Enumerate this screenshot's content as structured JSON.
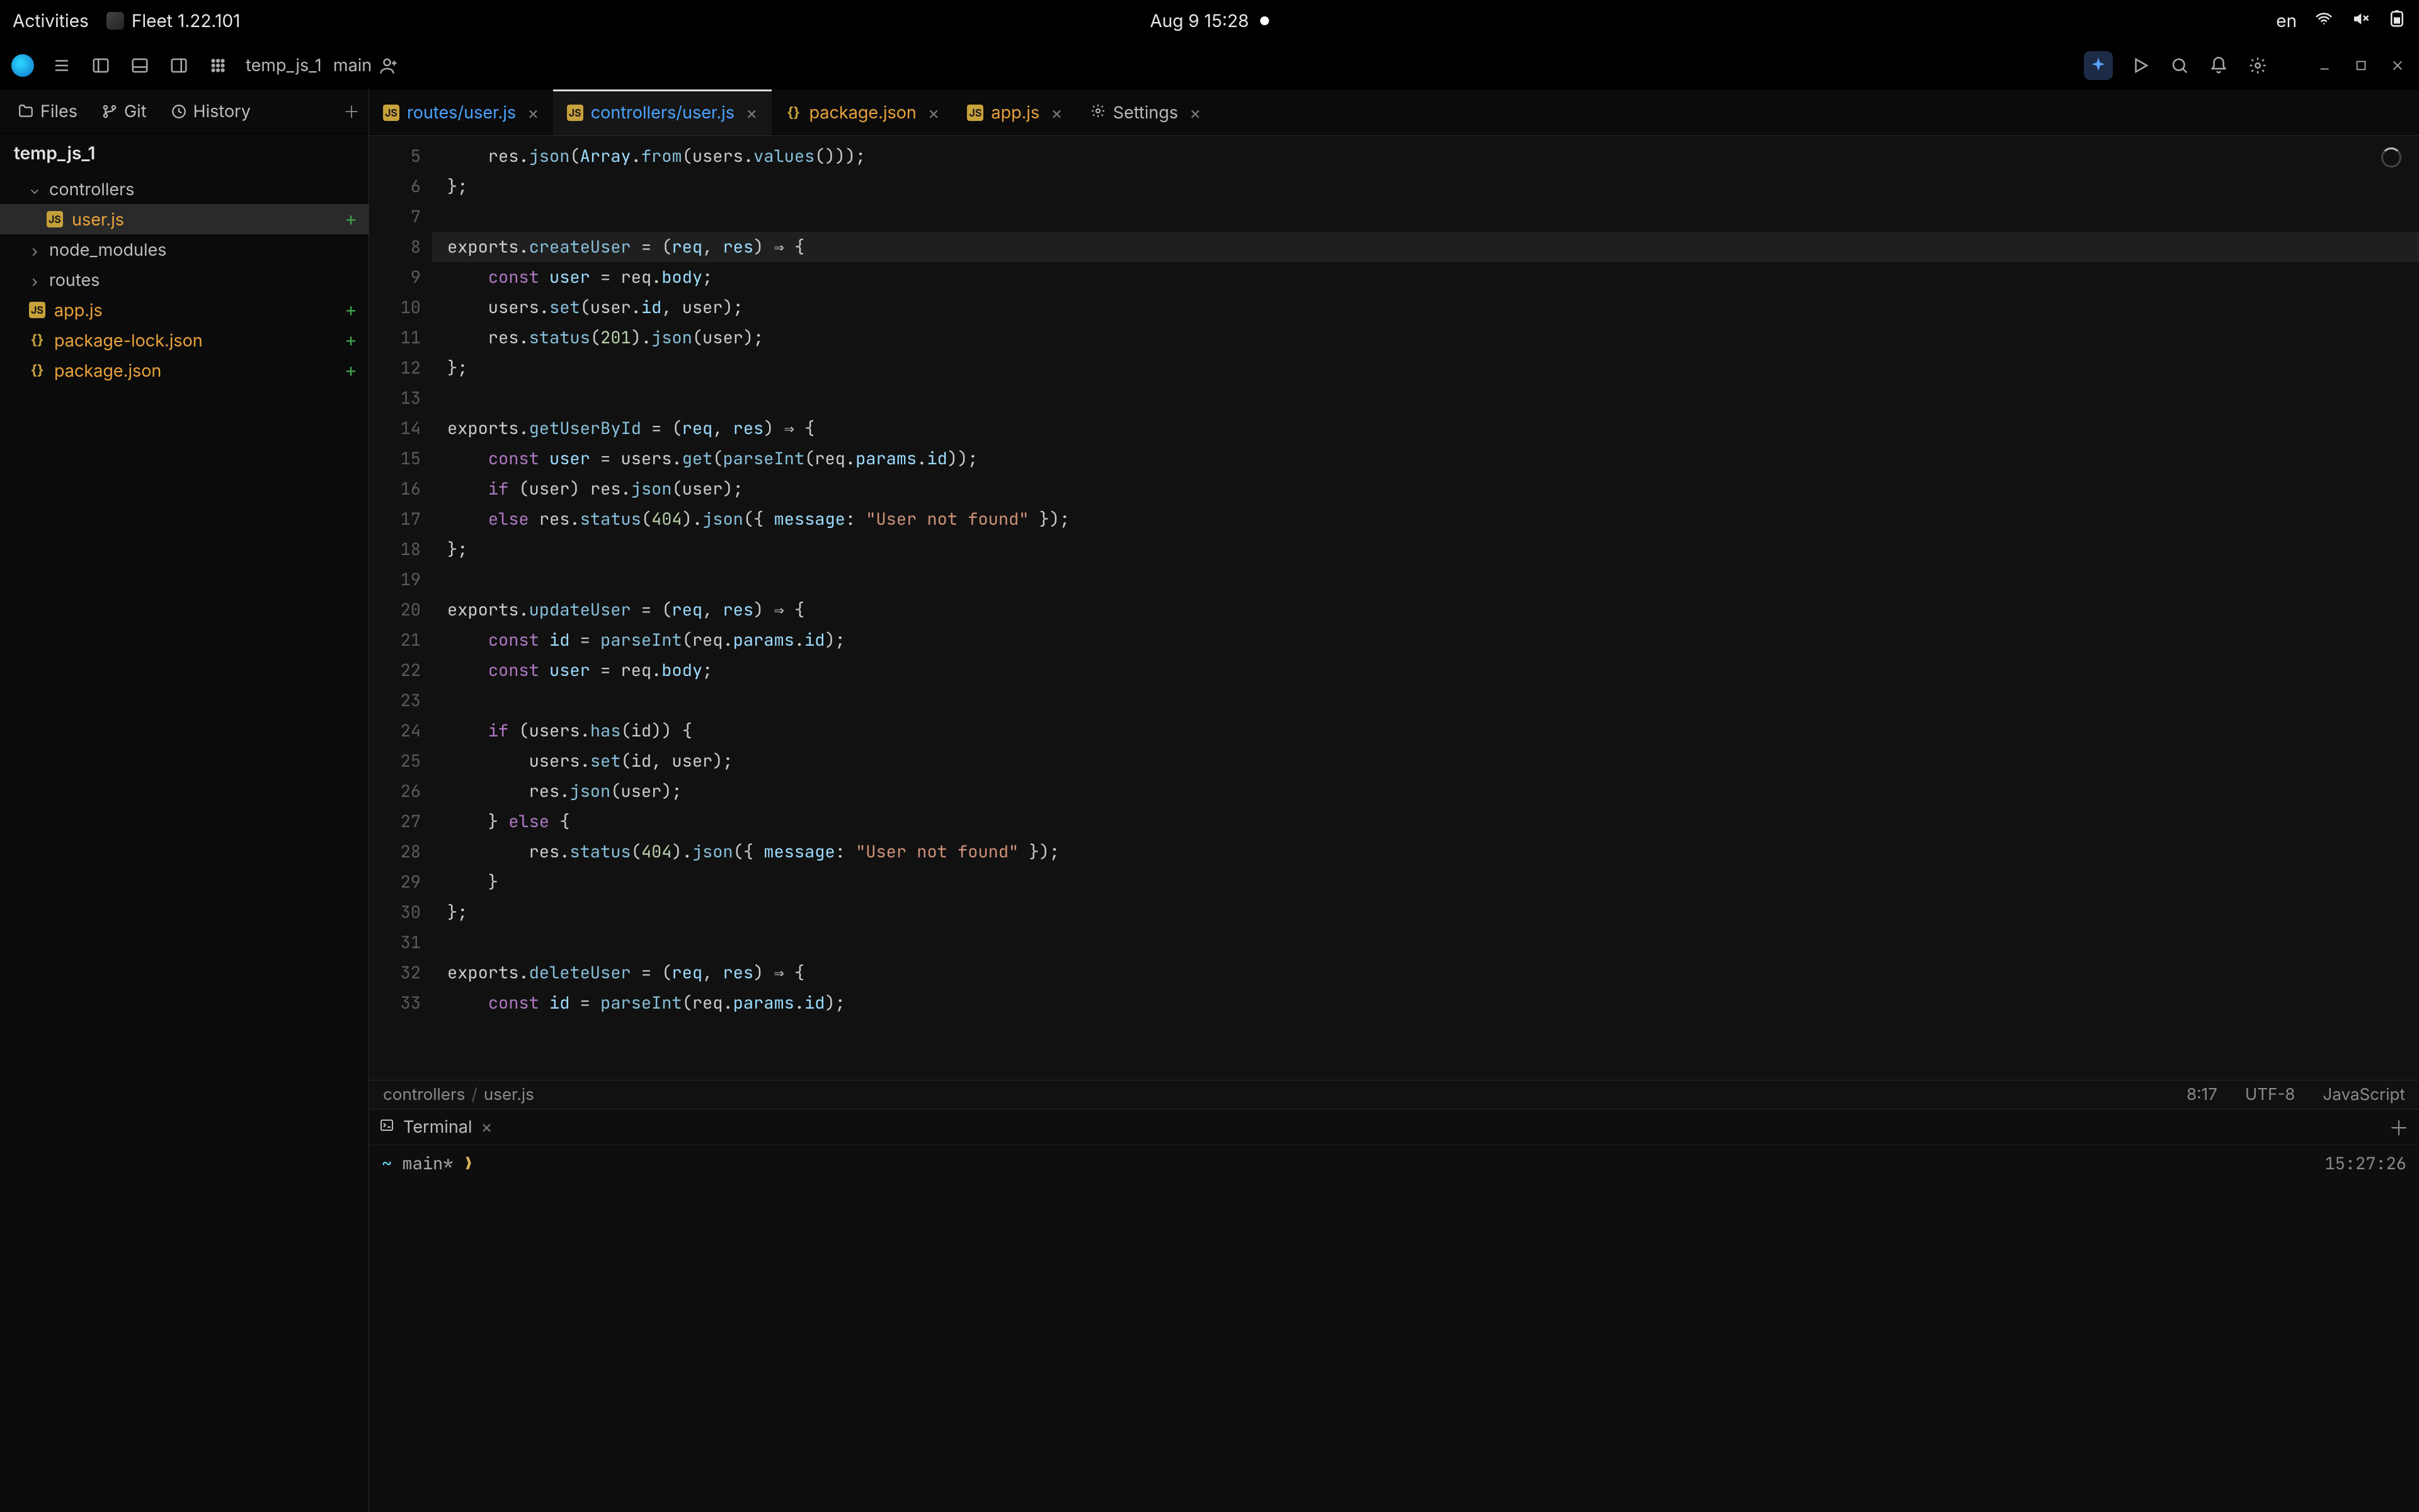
{
  "os": {
    "activities": "Activities",
    "app_name": "Fleet 1.22.101",
    "clock": "Aug 9  15:28",
    "lang": "en"
  },
  "toolbar": {
    "project": "temp_js_1",
    "branch": "main"
  },
  "sidebar": {
    "tabs": {
      "files": "Files",
      "git": "Git",
      "history": "History"
    },
    "root": "temp_js_1",
    "tree": [
      {
        "type": "dir",
        "name": "controllers",
        "expanded": true,
        "depth": 1
      },
      {
        "type": "file",
        "name": "user.js",
        "kind": "js",
        "depth": 2,
        "active": true,
        "added": true,
        "orange": true
      },
      {
        "type": "dir",
        "name": "node_modules",
        "expanded": false,
        "depth": 1
      },
      {
        "type": "dir",
        "name": "routes",
        "expanded": false,
        "depth": 1
      },
      {
        "type": "file",
        "name": "app.js",
        "kind": "js",
        "depth": 1,
        "added": true,
        "orange": true
      },
      {
        "type": "file",
        "name": "package-lock.json",
        "kind": "json",
        "depth": 1,
        "added": true,
        "orange": true
      },
      {
        "type": "file",
        "name": "package.json",
        "kind": "json",
        "depth": 1,
        "added": true,
        "orange": true
      }
    ]
  },
  "tabs": [
    {
      "label": "routes/user.js",
      "kind": "js",
      "color": "blue"
    },
    {
      "label": "controllers/user.js",
      "kind": "js",
      "active": true,
      "color": "blue"
    },
    {
      "label": "package.json",
      "kind": "json",
      "color": "orange"
    },
    {
      "label": "app.js",
      "kind": "js",
      "color": "orange"
    },
    {
      "label": "Settings",
      "kind": "gear"
    }
  ],
  "editor": {
    "first_line_no": 5,
    "highlight_line_no": 8,
    "lines": [
      [
        [
          "    res.",
          "p"
        ],
        [
          "json",
          "f"
        ],
        [
          "(",
          "p"
        ],
        [
          "Array",
          "v"
        ],
        [
          ".",
          "p"
        ],
        [
          "from",
          "f"
        ],
        [
          "(users.",
          "p"
        ],
        [
          "values",
          "f"
        ],
        [
          "()));",
          "p"
        ]
      ],
      [
        [
          "};",
          "p"
        ]
      ],
      [
        [
          "",
          "p"
        ]
      ],
      [
        [
          "exports.",
          "p"
        ],
        [
          "createUser",
          "f"
        ],
        [
          " = (",
          "p"
        ],
        [
          "req",
          "v"
        ],
        [
          ", ",
          "p"
        ],
        [
          "res",
          "v"
        ],
        [
          ") ",
          "p"
        ],
        [
          "⇒",
          "p"
        ],
        [
          " {",
          "p"
        ]
      ],
      [
        [
          "    ",
          "p"
        ],
        [
          "const",
          "k"
        ],
        [
          " ",
          "p"
        ],
        [
          "user",
          "v"
        ],
        [
          " = req.",
          "p"
        ],
        [
          "body",
          "pr"
        ],
        [
          ";",
          "p"
        ]
      ],
      [
        [
          "    users.",
          "p"
        ],
        [
          "set",
          "f"
        ],
        [
          "(user.",
          "p"
        ],
        [
          "id",
          "pr"
        ],
        [
          ", user);",
          "p"
        ]
      ],
      [
        [
          "    res.",
          "p"
        ],
        [
          "status",
          "f"
        ],
        [
          "(",
          "p"
        ],
        [
          "201",
          "n"
        ],
        [
          ").",
          "p"
        ],
        [
          "json",
          "f"
        ],
        [
          "(user);",
          "p"
        ]
      ],
      [
        [
          "};",
          "p"
        ]
      ],
      [
        [
          "",
          "p"
        ]
      ],
      [
        [
          "exports.",
          "p"
        ],
        [
          "getUserById",
          "f"
        ],
        [
          " = (",
          "p"
        ],
        [
          "req",
          "v"
        ],
        [
          ", ",
          "p"
        ],
        [
          "res",
          "v"
        ],
        [
          ") ",
          "p"
        ],
        [
          "⇒",
          "p"
        ],
        [
          " {",
          "p"
        ]
      ],
      [
        [
          "    ",
          "p"
        ],
        [
          "const",
          "k"
        ],
        [
          " ",
          "p"
        ],
        [
          "user",
          "v"
        ],
        [
          " = users.",
          "p"
        ],
        [
          "get",
          "f"
        ],
        [
          "(",
          "p"
        ],
        [
          "parseInt",
          "f"
        ],
        [
          "(req.",
          "p"
        ],
        [
          "params",
          "pr"
        ],
        [
          ".",
          "p"
        ],
        [
          "id",
          "pr"
        ],
        [
          "));",
          "p"
        ]
      ],
      [
        [
          "    ",
          "p"
        ],
        [
          "if",
          "k"
        ],
        [
          " (user) res.",
          "p"
        ],
        [
          "json",
          "f"
        ],
        [
          "(user);",
          "p"
        ]
      ],
      [
        [
          "    ",
          "p"
        ],
        [
          "else",
          "k"
        ],
        [
          " res.",
          "p"
        ],
        [
          "status",
          "f"
        ],
        [
          "(",
          "p"
        ],
        [
          "404",
          "n"
        ],
        [
          ").",
          "p"
        ],
        [
          "json",
          "f"
        ],
        [
          "({ ",
          "p"
        ],
        [
          "message",
          "pr"
        ],
        [
          ": ",
          "p"
        ],
        [
          "\"User not found\"",
          "s"
        ],
        [
          " });",
          "p"
        ]
      ],
      [
        [
          "};",
          "p"
        ]
      ],
      [
        [
          "",
          "p"
        ]
      ],
      [
        [
          "exports.",
          "p"
        ],
        [
          "updateUser",
          "f"
        ],
        [
          " = (",
          "p"
        ],
        [
          "req",
          "v"
        ],
        [
          ", ",
          "p"
        ],
        [
          "res",
          "v"
        ],
        [
          ") ",
          "p"
        ],
        [
          "⇒",
          "p"
        ],
        [
          " {",
          "p"
        ]
      ],
      [
        [
          "    ",
          "p"
        ],
        [
          "const",
          "k"
        ],
        [
          " ",
          "p"
        ],
        [
          "id",
          "v"
        ],
        [
          " = ",
          "p"
        ],
        [
          "parseInt",
          "f"
        ],
        [
          "(req.",
          "p"
        ],
        [
          "params",
          "pr"
        ],
        [
          ".",
          "p"
        ],
        [
          "id",
          "pr"
        ],
        [
          ");",
          "p"
        ]
      ],
      [
        [
          "    ",
          "p"
        ],
        [
          "const",
          "k"
        ],
        [
          " ",
          "p"
        ],
        [
          "user",
          "v"
        ],
        [
          " = req.",
          "p"
        ],
        [
          "body",
          "pr"
        ],
        [
          ";",
          "p"
        ]
      ],
      [
        [
          "",
          "p"
        ]
      ],
      [
        [
          "    ",
          "p"
        ],
        [
          "if",
          "k"
        ],
        [
          " (users.",
          "p"
        ],
        [
          "has",
          "f"
        ],
        [
          "(id)) {",
          "p"
        ]
      ],
      [
        [
          "        users.",
          "p"
        ],
        [
          "set",
          "f"
        ],
        [
          "(id, user);",
          "p"
        ]
      ],
      [
        [
          "        res.",
          "p"
        ],
        [
          "json",
          "f"
        ],
        [
          "(user);",
          "p"
        ]
      ],
      [
        [
          "    } ",
          "p"
        ],
        [
          "else",
          "k"
        ],
        [
          " {",
          "p"
        ]
      ],
      [
        [
          "        res.",
          "p"
        ],
        [
          "status",
          "f"
        ],
        [
          "(",
          "p"
        ],
        [
          "404",
          "n"
        ],
        [
          ").",
          "p"
        ],
        [
          "json",
          "f"
        ],
        [
          "({ ",
          "p"
        ],
        [
          "message",
          "pr"
        ],
        [
          ": ",
          "p"
        ],
        [
          "\"User not found\"",
          "s"
        ],
        [
          " });",
          "p"
        ]
      ],
      [
        [
          "    }",
          "p"
        ]
      ],
      [
        [
          "};",
          "p"
        ]
      ],
      [
        [
          "",
          "p"
        ]
      ],
      [
        [
          "exports.",
          "p"
        ],
        [
          "deleteUser",
          "f"
        ],
        [
          " = (",
          "p"
        ],
        [
          "req",
          "v"
        ],
        [
          ", ",
          "p"
        ],
        [
          "res",
          "v"
        ],
        [
          ") ",
          "p"
        ],
        [
          "⇒",
          "p"
        ],
        [
          " {",
          "p"
        ]
      ],
      [
        [
          "    ",
          "p"
        ],
        [
          "const",
          "k"
        ],
        [
          " ",
          "p"
        ],
        [
          "id",
          "v"
        ],
        [
          " = ",
          "p"
        ],
        [
          "parseInt",
          "f"
        ],
        [
          "(req.",
          "p"
        ],
        [
          "params",
          "pr"
        ],
        [
          ".",
          "p"
        ],
        [
          "id",
          "pr"
        ],
        [
          ");",
          "p"
        ]
      ]
    ]
  },
  "status": {
    "path_dir": "controllers",
    "path_file": "user.js",
    "cursor": "8:17",
    "encoding": "UTF-8",
    "language": "JavaScript"
  },
  "terminal": {
    "title": "Terminal",
    "prompt_tilde": "~",
    "prompt_branch": "main*",
    "prompt_arrow": "❯",
    "time": "15:27:26"
  }
}
